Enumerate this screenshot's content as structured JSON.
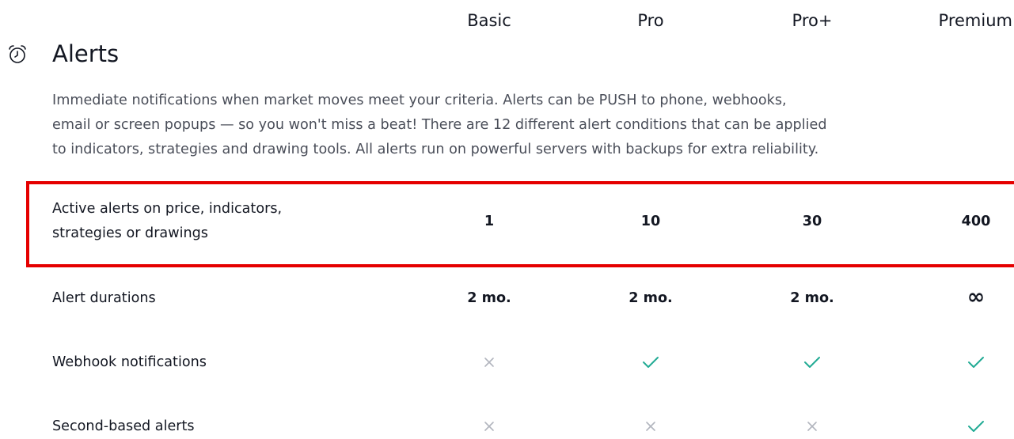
{
  "plans": [
    "Basic",
    "Pro",
    "Pro+",
    "Premium"
  ],
  "section": {
    "title": "Alerts",
    "icon": "alarm-clock-icon",
    "description_lines": [
      "Immediate notifications when market moves meet your criteria. Alerts can be PUSH to phone, webhooks,",
      "email or screen popups — so you won't miss a beat! There are 12 different alert conditions that can be applied",
      "to indicators, strategies and drawing tools. All alerts run on powerful servers with backups for extra reliability."
    ]
  },
  "rows": [
    {
      "label_lines": [
        "Active alerts on price, indicators,",
        "strategies or drawings"
      ],
      "values": [
        "1",
        "10",
        "30",
        "400"
      ],
      "highlighted": true
    },
    {
      "label_lines": [
        "Alert durations"
      ],
      "values": [
        "2 mo.",
        "2 mo.",
        "2 mo.",
        "∞"
      ]
    },
    {
      "label_lines": [
        "Webhook notifications"
      ],
      "values": [
        "no",
        "yes",
        "yes",
        "yes"
      ]
    },
    {
      "label_lines": [
        "Second-based alerts"
      ],
      "values": [
        "no",
        "no",
        "no",
        "yes"
      ]
    }
  ],
  "colors": {
    "check": "#22ab94",
    "cross": "#b2b5be",
    "highlight_border": "#e50000",
    "text": "#131722",
    "description": "#4a4e59"
  }
}
